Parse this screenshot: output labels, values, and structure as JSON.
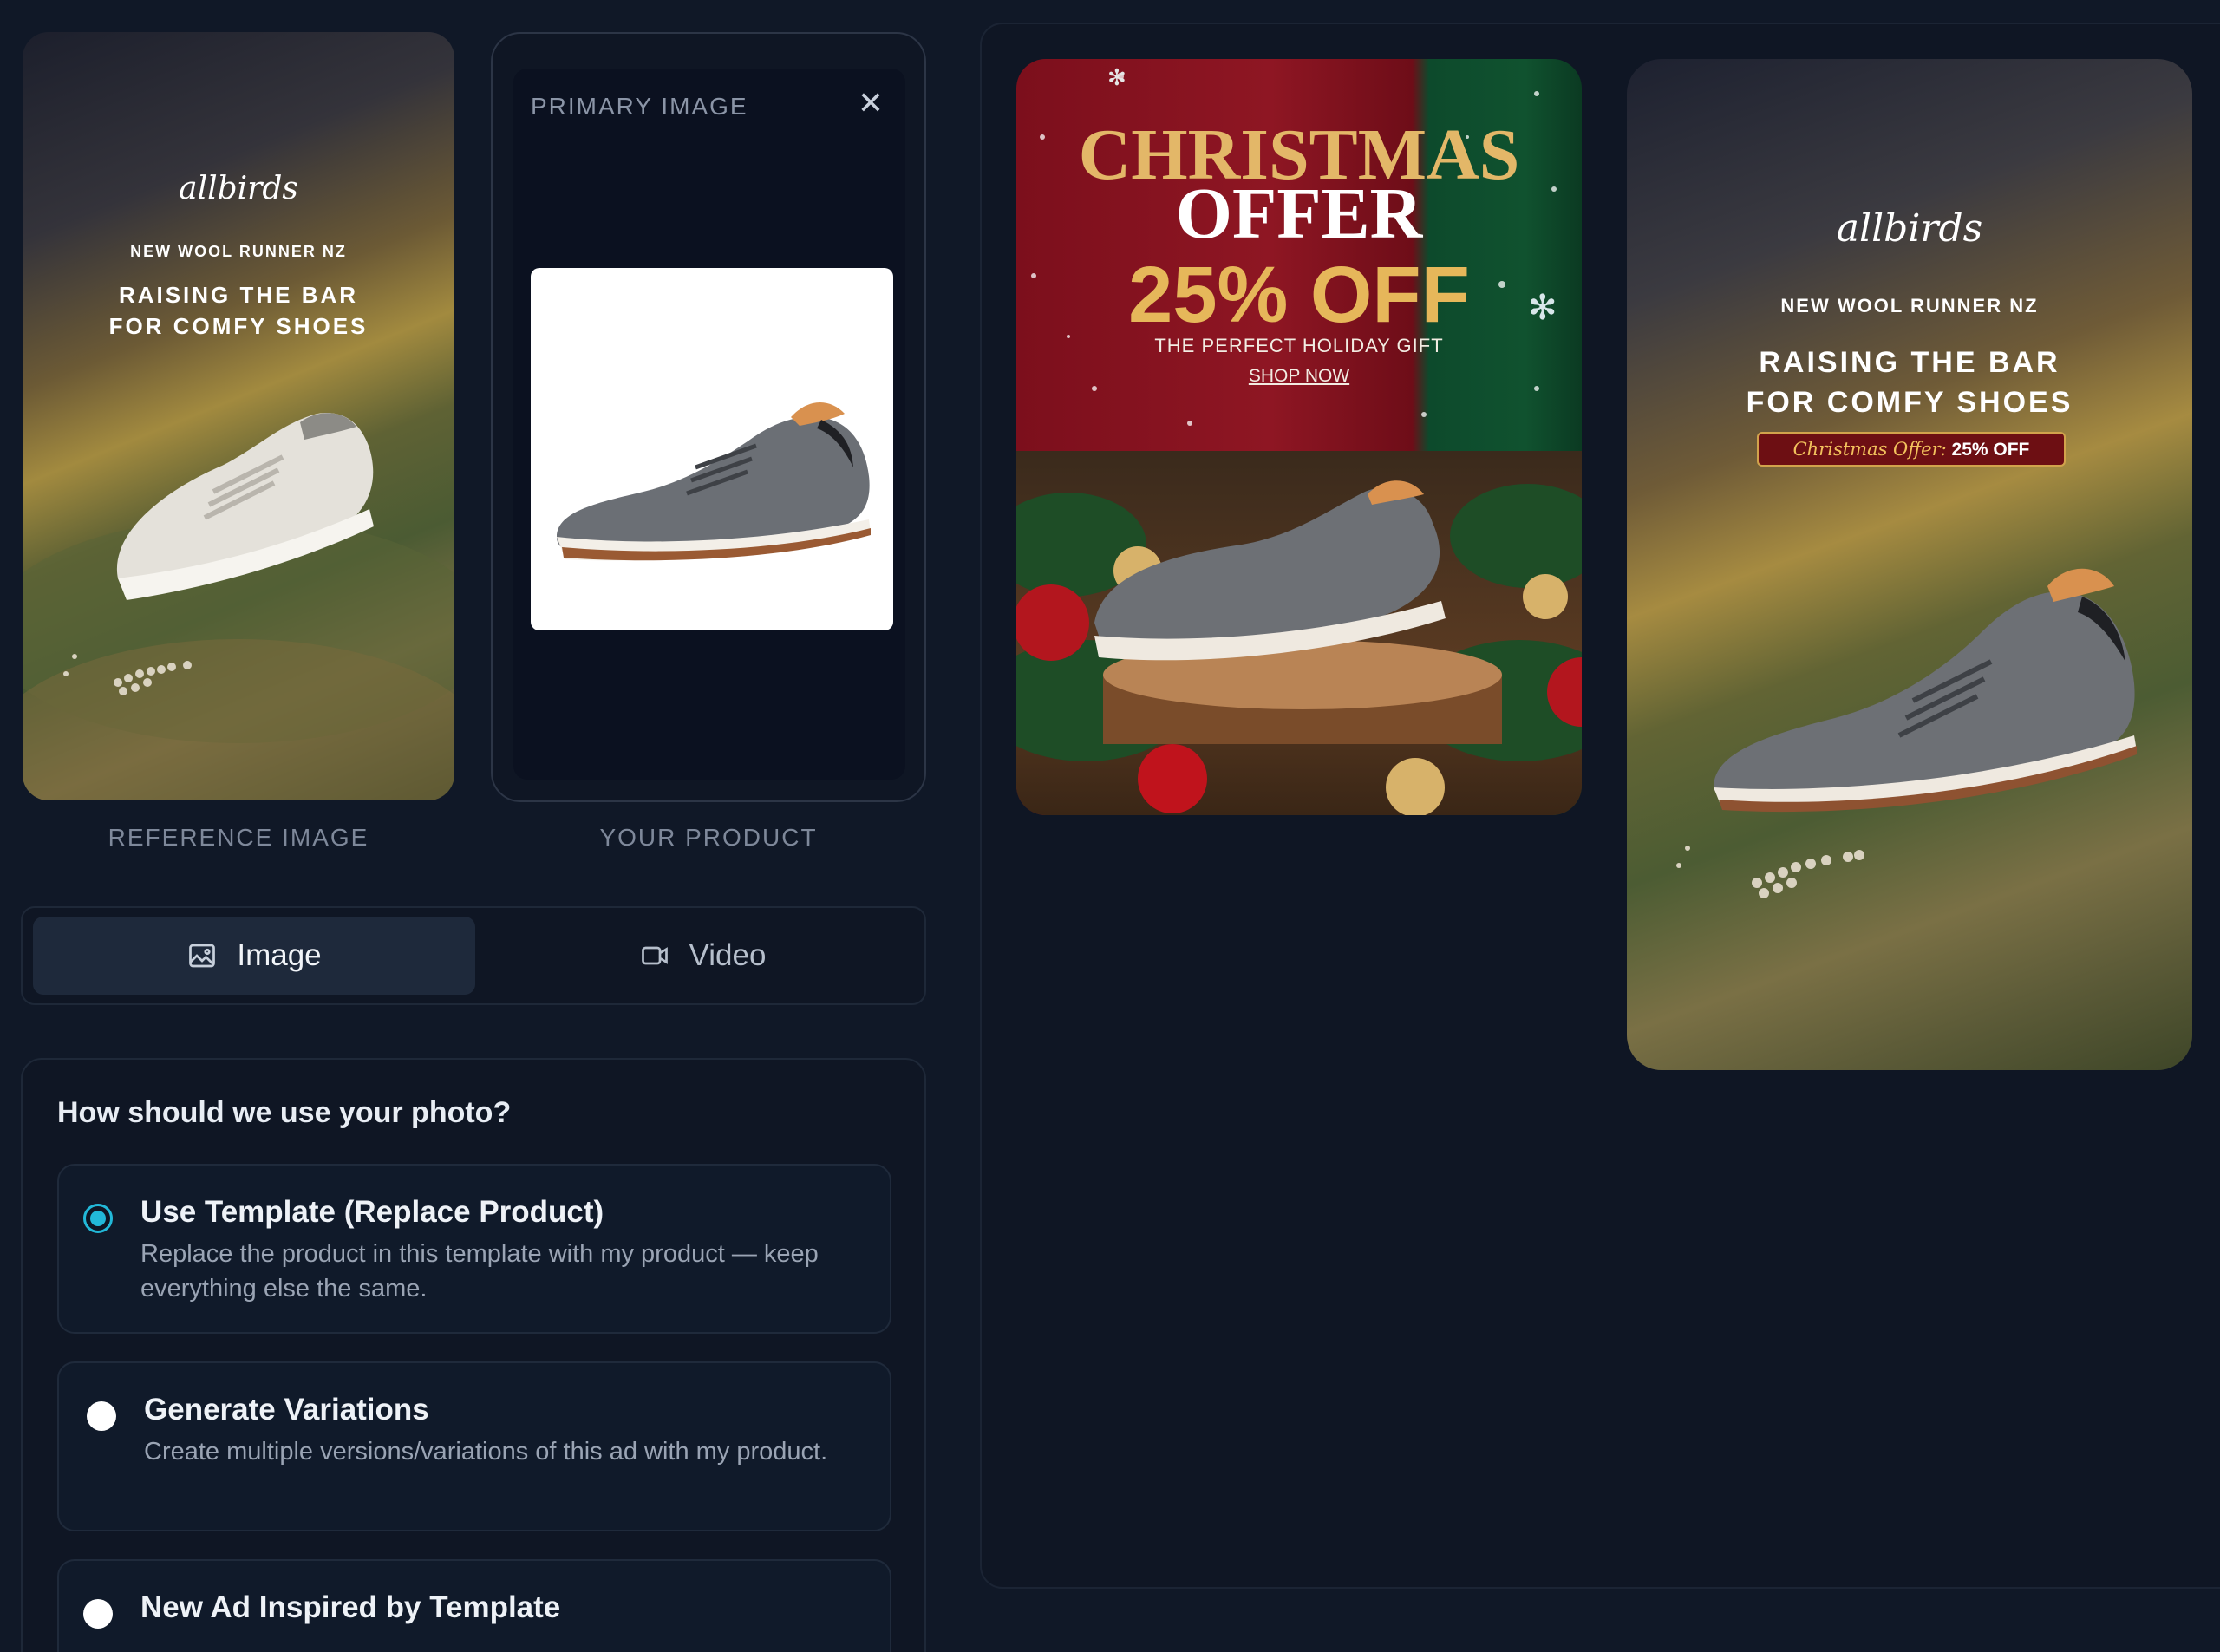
{
  "reference": {
    "brand": "allbirds",
    "subtitle": "NEW WOOL RUNNER NZ",
    "headline_1": "RAISING THE BAR",
    "headline_2": "FOR COMFY SHOES",
    "caption": "REFERENCE IMAGE"
  },
  "product": {
    "label": "PRIMARY IMAGE",
    "close_icon": "close-icon",
    "caption": "YOUR PRODUCT"
  },
  "mode_toggle": {
    "image_label": "Image",
    "video_label": "Video",
    "selected": "Image"
  },
  "usage": {
    "question": "How should we use your photo?",
    "options": [
      {
        "title": "Use Template (Replace Product)",
        "desc": "Replace the product in this template with my product — keep everything else the same.",
        "selected": true
      },
      {
        "title": "Generate Variations",
        "desc": "Create multiple versions/variations of this ad with my product.",
        "selected": false
      },
      {
        "title": "New Ad Inspired by Template",
        "desc": "",
        "selected": false
      }
    ]
  },
  "results": {
    "xmas": {
      "line1": "CHRISTMAS",
      "line2": "OFFER",
      "discount": "25% OFF",
      "tagline": "THE PERFECT HOLIDAY GIFT",
      "cta": "SHOP NOW"
    },
    "allbirds": {
      "brand": "allbirds",
      "subtitle": "NEW WOOL RUNNER NZ",
      "headline_1": "RAISING THE BAR",
      "headline_2": "FOR COMFY SHOES",
      "badge_script": "Christmas Offer:",
      "badge_text": "25% OFF"
    }
  },
  "colors": {
    "background": "#101827",
    "accent": "#22b8d8",
    "panel": "#0f1624"
  }
}
